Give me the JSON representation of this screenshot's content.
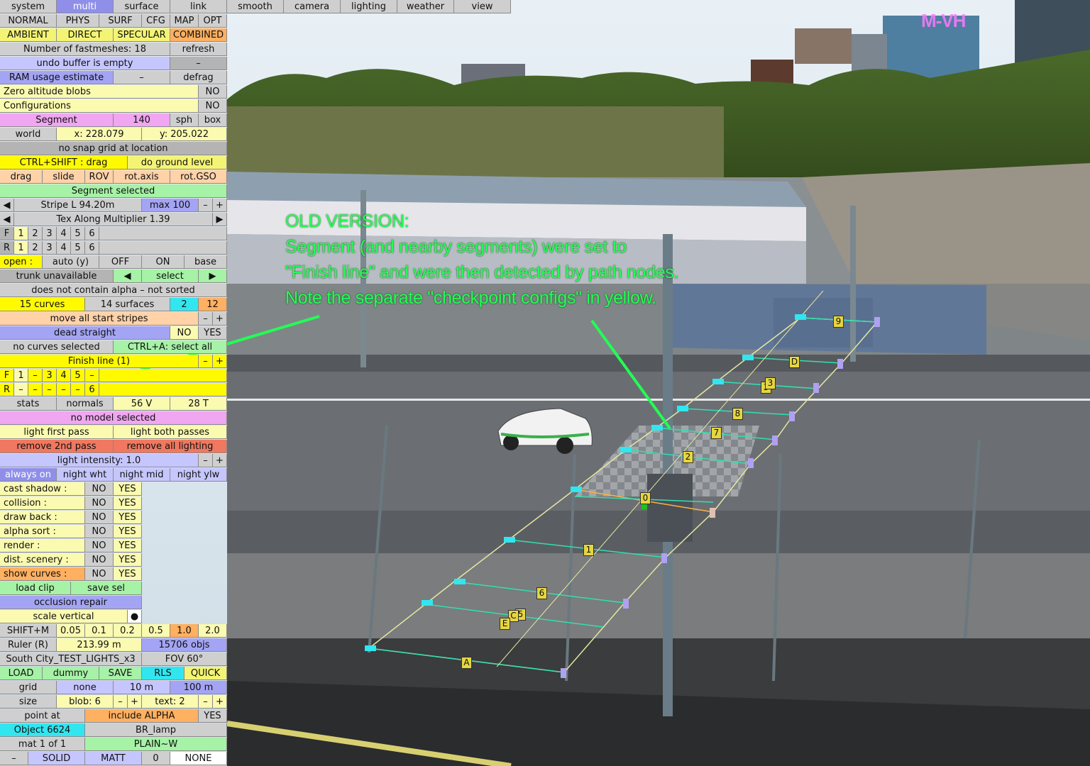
{
  "watermark": "M-VH",
  "annotation": {
    "lines": [
      "OLD VERSION:",
      "Segment (and nearby segments) were set to",
      "\"Finish line\" and were then detected by path nodes.",
      "Note the separate \"checkpoint configs\" in yellow."
    ]
  },
  "colors": {
    "annotation_text": "#22ff55",
    "accent_cyan": "#32e6f0",
    "panel_yellow": "#f4f474"
  },
  "tabs": [
    "system",
    "multi",
    "surface",
    "link",
    "smooth",
    "camera",
    "lighting",
    "weather",
    "view"
  ],
  "panel": {
    "modes": [
      "NORMAL",
      "PHYS",
      "SURF",
      "CFG",
      "MAP",
      "OPT"
    ],
    "light_modes": [
      "AMBIENT",
      "DIRECT",
      "SPECULAR",
      "COMBINED"
    ],
    "fastmeshes": "Number of fastmeshes: 18",
    "refresh": "refresh",
    "undo": "undo buffer is empty",
    "dash": "–",
    "ram": "RAM usage estimate",
    "defrag": "defrag",
    "zero_alt": "Zero altitude blobs",
    "no": "NO",
    "yes": "YES",
    "configurations": "Configurations",
    "segment": "Segment",
    "segment_num": "140",
    "sph": "sph",
    "box": "box",
    "world": "world",
    "world_x": "x: 228.079",
    "world_y": "y: 205.022",
    "snap": "no snap grid at location",
    "ctrl_shift": "CTRL+SHIFT : drag",
    "ground": "do ground level",
    "drag_row": [
      "drag",
      "slide",
      "ROV",
      "rot.axis",
      "rot.GSO"
    ],
    "seg_selected": "Segment selected",
    "left_arrow": "◀",
    "right_arrow": "▶",
    "stripe": "Stripe L 94.20m",
    "max": "max 100",
    "minus": "–",
    "plus": "+",
    "tex_mult": "Tex Along Multiplier 1.39",
    "f_label": "F",
    "r_label": "R",
    "digits": [
      "1",
      "2",
      "3",
      "4",
      "5",
      "6"
    ],
    "open": "open :",
    "auto": "auto (y)",
    "off": "OFF",
    "on": "ON",
    "base": "base",
    "trunk": "trunk unavailable",
    "select": "select",
    "alpha": "does not contain alpha – not sorted",
    "curves": "15 curves",
    "surfaces": "14 surfaces",
    "n2": "2",
    "n12": "12",
    "move_stripes": "move all start stripes",
    "dead": "dead straight",
    "no_curves": "no curves selected",
    "ctrl_a": "CTRL+A: select all",
    "finish": "Finish line (1)",
    "fin_f": [
      "1",
      "–",
      "3",
      "4",
      "5",
      "–"
    ],
    "fin_r": [
      "–",
      "–",
      "–",
      "–",
      "–",
      "6"
    ],
    "stats": "stats",
    "normals": "normals",
    "verts": "56 V",
    "tris": "28 T",
    "no_model": "no model selected",
    "light_first": "light first pass",
    "light_both": "light both passes",
    "remove_2nd": "remove 2nd pass",
    "remove_all": "remove all lighting",
    "intensity": "light intensity: 1.0",
    "night": [
      "always on",
      "night wht",
      "night mid",
      "night ylw"
    ],
    "props": [
      "cast shadow :",
      "collision :",
      "draw back :",
      "alpha sort :",
      "render :",
      "dist. scenery :",
      "show curves :"
    ],
    "load_clip": "load clip",
    "save_sel": "save sel",
    "occlusion": "occlusion repair",
    "scale_vert": "scale vertical",
    "dot": "●",
    "shiftm": "SHIFT+M",
    "scales": [
      "0.05",
      "0.1",
      "0.2",
      "0.5",
      "1.0",
      "2.0"
    ],
    "ruler": "Ruler (R)",
    "ruler_val": "213.99 m",
    "objs": "15706 objs",
    "track": "South City_TEST_LIGHTS_x3",
    "fov": "FOV 60°",
    "file_btns": [
      "LOAD",
      "dummy",
      "SAVE",
      "RLS",
      "QUICK"
    ],
    "grid": "grid",
    "grid_opts": [
      "none",
      "10 m",
      "100 m"
    ],
    "size": "size",
    "blob": "blob: 6",
    "text": "text: 2",
    "point_at": "point at",
    "include_alpha": "include ALPHA",
    "object": "Object 6624",
    "br_lamp": "BR_lamp",
    "mat": "mat 1 of 1",
    "plain": "PLAIN~W",
    "solid": "SOLID",
    "matt": "MATT",
    "zero": "0",
    "none": "NONE"
  },
  "nodes": [
    "9",
    "D",
    "3",
    "3",
    "8",
    "7",
    "2",
    "0",
    "1",
    "6",
    "5",
    "C",
    "E",
    "A"
  ]
}
